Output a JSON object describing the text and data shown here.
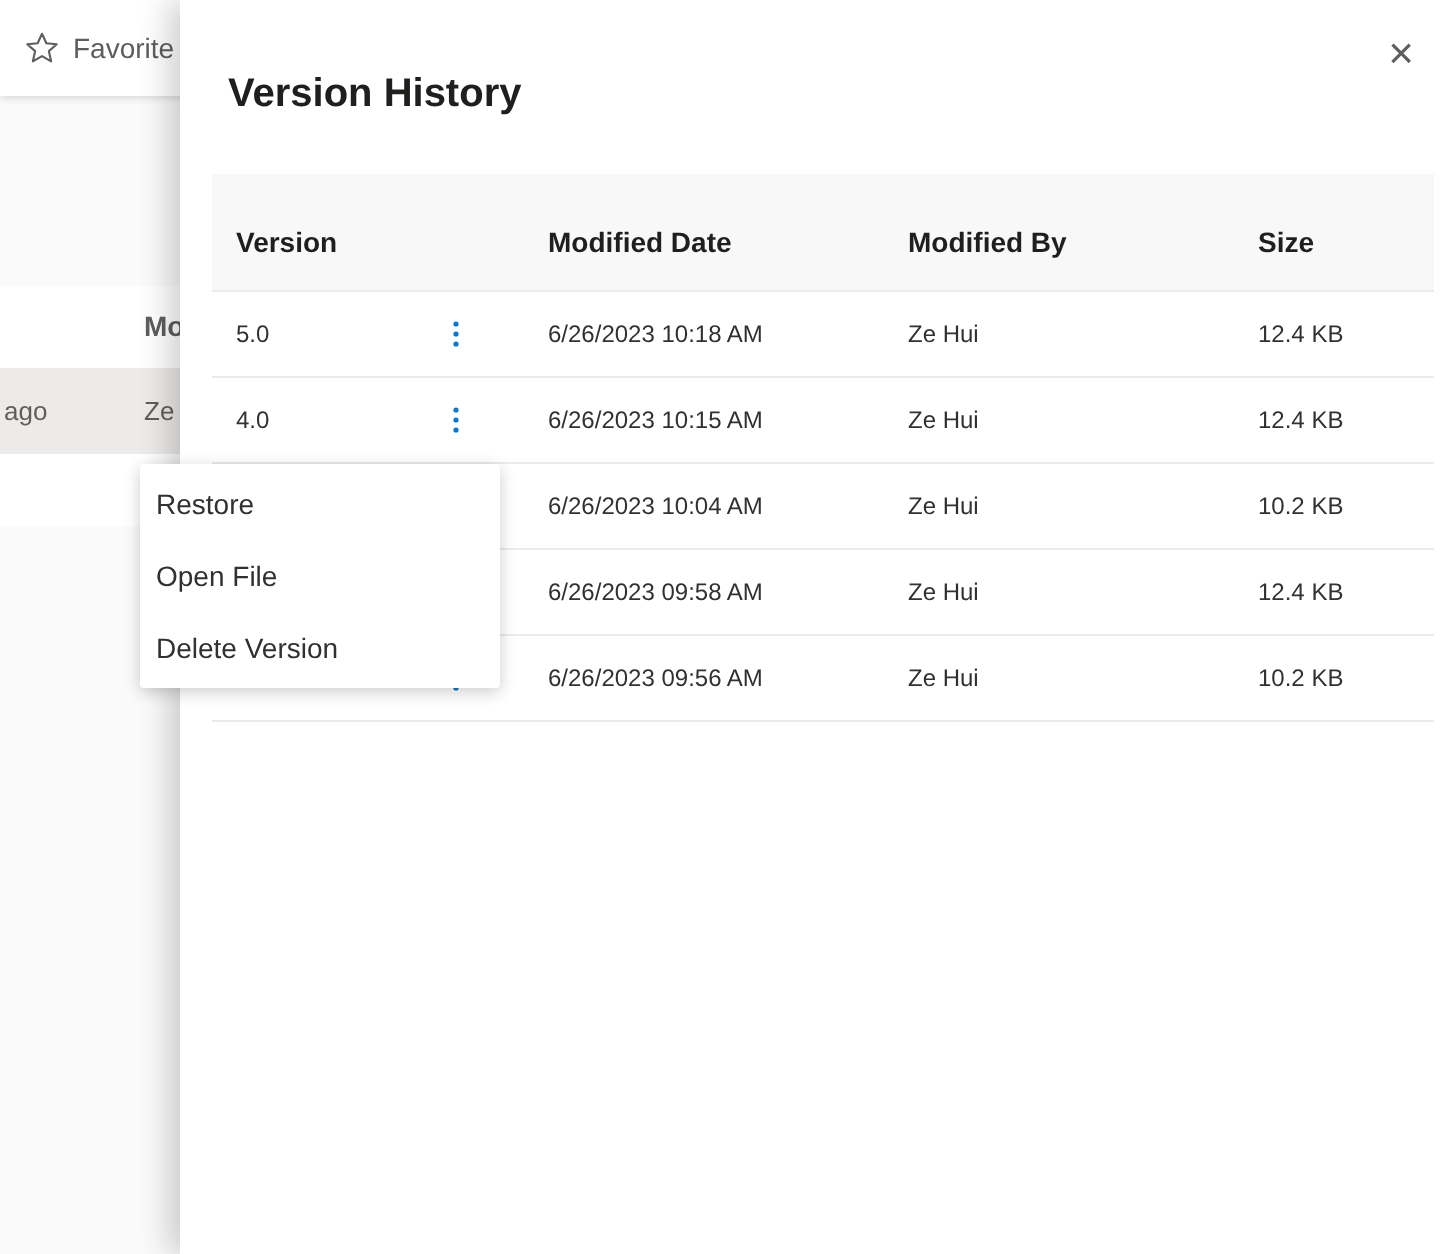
{
  "background": {
    "toolbar": {
      "favorite_label": "Favorite"
    },
    "list": {
      "column_header": "Mo",
      "row": {
        "cell_1": "ago",
        "cell_2": "Ze",
        "selected": true
      }
    }
  },
  "panel": {
    "title": "Version History",
    "close": "×",
    "table": {
      "columns": [
        "Version",
        "Modified Date",
        "Modified By",
        "Size"
      ],
      "rows": [
        {
          "version": "5.0",
          "date": "6/26/2023 10:18 AM",
          "by": "Ze Hui",
          "size": "12.4 KB"
        },
        {
          "version": "4.0",
          "date": "6/26/2023 10:15 AM",
          "by": "Ze Hui",
          "size": "12.4 KB"
        },
        {
          "date": "6/26/2023 10:04 AM",
          "by": "Ze Hui",
          "size": "10.2 KB"
        },
        {
          "date": "6/26/2023 09:58 AM",
          "by": "Ze Hui",
          "size": "12.4 KB"
        },
        {
          "date": "6/26/2023 09:56 AM",
          "by": "Ze Hui",
          "size": "10.2 KB"
        }
      ]
    }
  },
  "context_menu": {
    "items": [
      "Restore",
      "Open File",
      "Delete Version"
    ]
  }
}
